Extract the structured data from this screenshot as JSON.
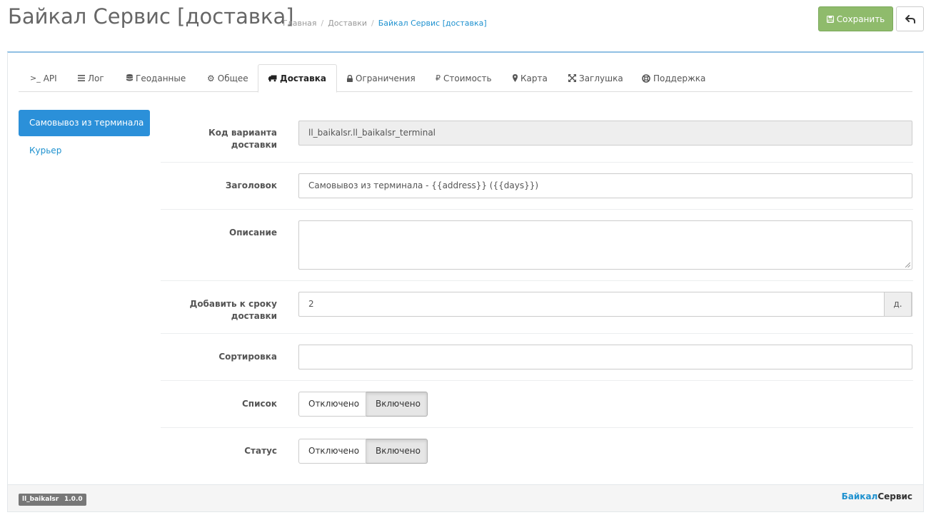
{
  "header": {
    "title": "Байкал Сервис [доставка]",
    "breadcrumbs": [
      "Главная",
      "Доставки",
      "Байкал Сервис [доставка]"
    ],
    "breadcrumb_separator": "/",
    "save_label": "Сохранить",
    "save_icon": "save-icon",
    "back_icon": "reply-icon",
    "save_color": "#8fbb6c"
  },
  "tabs": [
    {
      "label": "API",
      "icon": "terminal-icon"
    },
    {
      "label": "Лог",
      "icon": "bars-icon"
    },
    {
      "label": "Геоданные",
      "icon": "database-icon"
    },
    {
      "label": "Общее",
      "icon": "gear-icon"
    },
    {
      "label": "Доставка",
      "icon": "truck-icon",
      "active": true
    },
    {
      "label": "Ограничения",
      "icon": "lock-icon"
    },
    {
      "label": "Стоимость",
      "icon": "ruble-icon"
    },
    {
      "label": "Карта",
      "icon": "map-marker-icon"
    },
    {
      "label": "Заглушка",
      "icon": "arrows-icon"
    },
    {
      "label": "Поддержка",
      "icon": "life-ring-icon"
    }
  ],
  "terminal_glyph": ">_",
  "sidebar": {
    "items": [
      {
        "label": "Самовывоз из терминала",
        "active": true
      },
      {
        "label": "Курьер",
        "active": false
      }
    ]
  },
  "form": {
    "code": {
      "label_line1": "Код варианта",
      "label_line2": "доставки",
      "value": "ll_baikalsr.ll_baikalsr_terminal"
    },
    "heading": {
      "label": "Заголовок",
      "value": "Самовывоз из терминала - {{address}} ({{days}})"
    },
    "description": {
      "label": "Описание",
      "value": ""
    },
    "add_days": {
      "label_line1": "Добавить к сроку",
      "label_line2": "доставки",
      "value": "2",
      "addon": "д."
    },
    "sort": {
      "label": "Сортировка",
      "value": ""
    },
    "list": {
      "label": "Список",
      "off_label": "Отключено",
      "on_label": "Включено",
      "selected": "Включено"
    },
    "status": {
      "label": "Статус",
      "off_label": "Отключено",
      "on_label": "Включено",
      "selected": "Включено"
    }
  },
  "footer": {
    "badges": [
      "ll_baikalsr",
      "1.0.0"
    ],
    "brand_part1": "Байкал",
    "brand_part2": "Сервис",
    "brand_color": "#1e91cf"
  }
}
